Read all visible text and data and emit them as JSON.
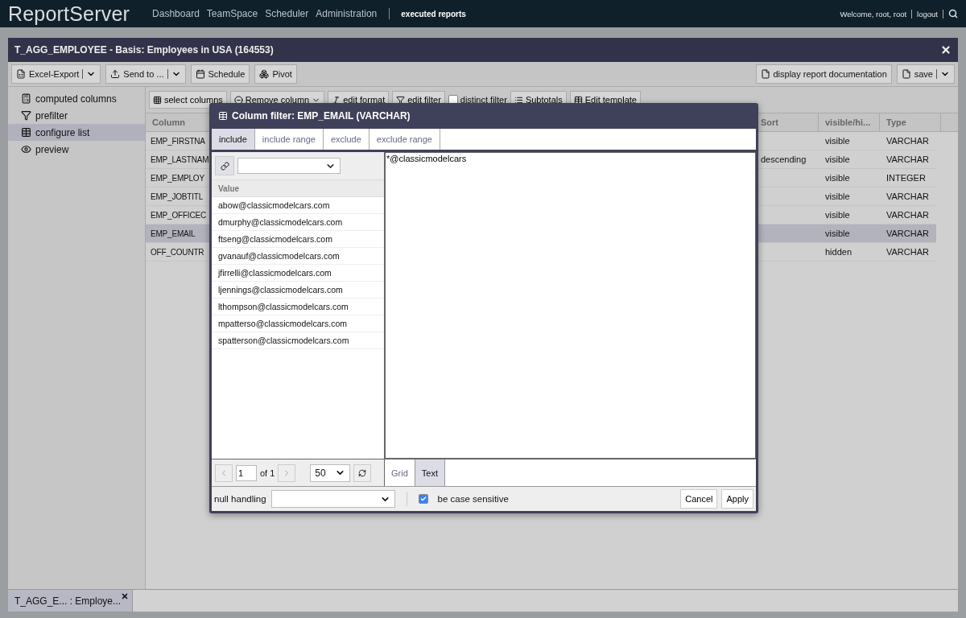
{
  "header": {
    "logo": "**Report**Server",
    "nav": [
      {
        "label": "Dashboard",
        "selected": false
      },
      {
        "label": "TeamSpace",
        "selected": false
      },
      {
        "label": "Scheduler",
        "selected": false
      },
      {
        "label": "Administration",
        "selected": false
      },
      {
        "label": "executed reports",
        "selected": true
      }
    ],
    "welcome": "Welcome, root, root",
    "logout": "logout"
  },
  "report": {
    "title": "T_AGG_EMPLOYEE - Basis: Employees in USA (164553)",
    "toolbar_left": [
      {
        "label": "Excel-Export",
        "kind": "split"
      },
      {
        "label": "Send to ...",
        "kind": "split"
      },
      {
        "label": "Schedule",
        "kind": "plain"
      },
      {
        "label": "Pivot",
        "kind": "plain"
      }
    ],
    "toolbar_right": [
      {
        "label": "display report documentation",
        "kind": "plain"
      },
      {
        "label": "save",
        "kind": "split"
      }
    ],
    "sidebar": [
      {
        "label": "computed columns",
        "selected": false
      },
      {
        "label": "prefilter",
        "selected": false
      },
      {
        "label": "configure list",
        "selected": true
      },
      {
        "label": "preview",
        "selected": false
      }
    ],
    "content_toolbar": [
      {
        "label": "select columns",
        "kind": "button"
      },
      {
        "label": "Remove column",
        "kind": "split"
      },
      {
        "label": "edit format",
        "kind": "button"
      },
      {
        "label": "edit filter",
        "kind": "button"
      },
      {
        "label": "distinct filter",
        "kind": "checkbox",
        "checked": false
      },
      {
        "label": "Subtotals",
        "kind": "button"
      },
      {
        "label": "Edit template",
        "kind": "button"
      }
    ],
    "table": {
      "columns": [
        "Column",
        "Sort",
        "visible/hi...",
        "Type"
      ],
      "rows": [
        {
          "cells": [
            "EMP_FIRSTNA",
            "",
            "visible",
            "VARCHAR"
          ],
          "selected": false
        },
        {
          "cells": [
            "EMP_LASTNAM",
            "descending",
            "visible",
            "VARCHAR"
          ],
          "selected": false
        },
        {
          "cells": [
            "EMP_EMPLOY",
            "",
            "visible",
            "INTEGER"
          ],
          "selected": false
        },
        {
          "cells": [
            "EMP_JOBTITL",
            "",
            "visible",
            "VARCHAR"
          ],
          "selected": false
        },
        {
          "cells": [
            "EMP_OFFICEC",
            "",
            "visible",
            "VARCHAR"
          ],
          "selected": false
        },
        {
          "cells": [
            "EMP_EMAIL",
            "",
            "visible",
            "VARCHAR"
          ],
          "selected": true
        },
        {
          "cells": [
            "OFF_COUNTR",
            "",
            "hidden",
            "VARCHAR"
          ],
          "selected": false
        }
      ]
    }
  },
  "dialog": {
    "title": "Column filter: EMP_EMAIL (VARCHAR)",
    "tabs": [
      {
        "label": "include",
        "selected": true
      },
      {
        "label": "include range",
        "selected": false
      },
      {
        "label": "exclude",
        "selected": false
      },
      {
        "label": "exclude range",
        "selected": false
      }
    ],
    "value_header": "Value",
    "values": [
      "abow@classicmodelcars.com",
      "dmurphy@classicmodelcars.com",
      "ftseng@classicmodelcars.com",
      "gvanauf@classicmodelcars.com",
      "jfirrelli@classicmodelcars.com",
      "ljennings@classicmodelcars.com",
      "lthompson@classicmodelcars.com",
      "mpatterso@classicmodelcars.com",
      "spatterson@classicmodelcars.com"
    ],
    "text_value": "*@classicmodelcars",
    "pager": {
      "page": "1",
      "of": "of 1",
      "page_size": "50"
    },
    "view_tabs": [
      {
        "label": "Grid",
        "selected": false
      },
      {
        "label": "Text",
        "selected": true
      }
    ],
    "null_handling_label": "null handling",
    "case_sensitive": {
      "label": "be case sensitive",
      "checked": true
    },
    "buttons": [
      "Cancel",
      "Apply"
    ]
  },
  "taskbar": [
    {
      "label": "T_AGG_E... : Employe...",
      "selected": true
    }
  ]
}
